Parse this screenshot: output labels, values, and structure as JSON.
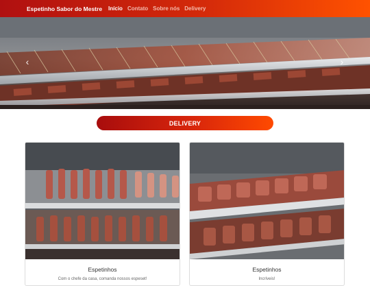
{
  "navbar": {
    "brand": "Espetinho Sabor do Mestre",
    "links": [
      {
        "label": "Início",
        "active": true
      },
      {
        "label": "Contato",
        "active": false
      },
      {
        "label": "Sobre nós",
        "active": false
      },
      {
        "label": "Delivery",
        "active": false
      }
    ],
    "gradient": [
      "#b01010",
      "#ff5200"
    ]
  },
  "hero": {
    "prev_icon": "chevron-left-icon",
    "next_icon": "chevron-right-icon"
  },
  "delivery_button": {
    "label": "DELIVERY"
  },
  "cards": [
    {
      "title": "Espetinhos",
      "text": "Com o chefe da casa, comanda nossos espeset!"
    },
    {
      "title": "Espetinhos",
      "text": "Incríveis!"
    }
  ]
}
